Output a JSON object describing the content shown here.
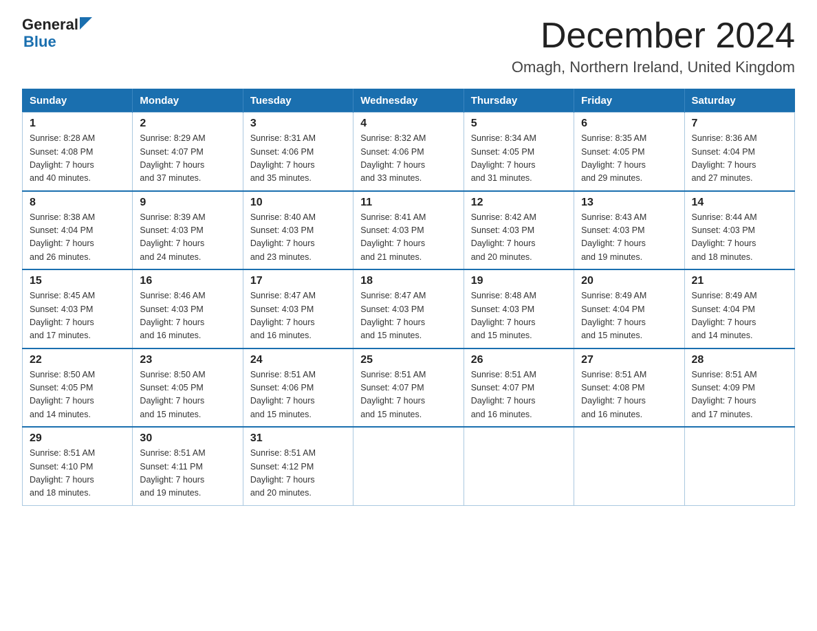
{
  "logo": {
    "line1": "General",
    "arrow": true,
    "line2": "Blue"
  },
  "title": "December 2024",
  "subtitle": "Omagh, Northern Ireland, United Kingdom",
  "days_of_week": [
    "Sunday",
    "Monday",
    "Tuesday",
    "Wednesday",
    "Thursday",
    "Friday",
    "Saturday"
  ],
  "weeks": [
    [
      {
        "day": "1",
        "sunrise": "8:28 AM",
        "sunset": "4:08 PM",
        "daylight": "7 hours and 40 minutes."
      },
      {
        "day": "2",
        "sunrise": "8:29 AM",
        "sunset": "4:07 PM",
        "daylight": "7 hours and 37 minutes."
      },
      {
        "day": "3",
        "sunrise": "8:31 AM",
        "sunset": "4:06 PM",
        "daylight": "7 hours and 35 minutes."
      },
      {
        "day": "4",
        "sunrise": "8:32 AM",
        "sunset": "4:06 PM",
        "daylight": "7 hours and 33 minutes."
      },
      {
        "day": "5",
        "sunrise": "8:34 AM",
        "sunset": "4:05 PM",
        "daylight": "7 hours and 31 minutes."
      },
      {
        "day": "6",
        "sunrise": "8:35 AM",
        "sunset": "4:05 PM",
        "daylight": "7 hours and 29 minutes."
      },
      {
        "day": "7",
        "sunrise": "8:36 AM",
        "sunset": "4:04 PM",
        "daylight": "7 hours and 27 minutes."
      }
    ],
    [
      {
        "day": "8",
        "sunrise": "8:38 AM",
        "sunset": "4:04 PM",
        "daylight": "7 hours and 26 minutes."
      },
      {
        "day": "9",
        "sunrise": "8:39 AM",
        "sunset": "4:03 PM",
        "daylight": "7 hours and 24 minutes."
      },
      {
        "day": "10",
        "sunrise": "8:40 AM",
        "sunset": "4:03 PM",
        "daylight": "7 hours and 23 minutes."
      },
      {
        "day": "11",
        "sunrise": "8:41 AM",
        "sunset": "4:03 PM",
        "daylight": "7 hours and 21 minutes."
      },
      {
        "day": "12",
        "sunrise": "8:42 AM",
        "sunset": "4:03 PM",
        "daylight": "7 hours and 20 minutes."
      },
      {
        "day": "13",
        "sunrise": "8:43 AM",
        "sunset": "4:03 PM",
        "daylight": "7 hours and 19 minutes."
      },
      {
        "day": "14",
        "sunrise": "8:44 AM",
        "sunset": "4:03 PM",
        "daylight": "7 hours and 18 minutes."
      }
    ],
    [
      {
        "day": "15",
        "sunrise": "8:45 AM",
        "sunset": "4:03 PM",
        "daylight": "7 hours and 17 minutes."
      },
      {
        "day": "16",
        "sunrise": "8:46 AM",
        "sunset": "4:03 PM",
        "daylight": "7 hours and 16 minutes."
      },
      {
        "day": "17",
        "sunrise": "8:47 AM",
        "sunset": "4:03 PM",
        "daylight": "7 hours and 16 minutes."
      },
      {
        "day": "18",
        "sunrise": "8:47 AM",
        "sunset": "4:03 PM",
        "daylight": "7 hours and 15 minutes."
      },
      {
        "day": "19",
        "sunrise": "8:48 AM",
        "sunset": "4:03 PM",
        "daylight": "7 hours and 15 minutes."
      },
      {
        "day": "20",
        "sunrise": "8:49 AM",
        "sunset": "4:04 PM",
        "daylight": "7 hours and 15 minutes."
      },
      {
        "day": "21",
        "sunrise": "8:49 AM",
        "sunset": "4:04 PM",
        "daylight": "7 hours and 14 minutes."
      }
    ],
    [
      {
        "day": "22",
        "sunrise": "8:50 AM",
        "sunset": "4:05 PM",
        "daylight": "7 hours and 14 minutes."
      },
      {
        "day": "23",
        "sunrise": "8:50 AM",
        "sunset": "4:05 PM",
        "daylight": "7 hours and 15 minutes."
      },
      {
        "day": "24",
        "sunrise": "8:51 AM",
        "sunset": "4:06 PM",
        "daylight": "7 hours and 15 minutes."
      },
      {
        "day": "25",
        "sunrise": "8:51 AM",
        "sunset": "4:07 PM",
        "daylight": "7 hours and 15 minutes."
      },
      {
        "day": "26",
        "sunrise": "8:51 AM",
        "sunset": "4:07 PM",
        "daylight": "7 hours and 16 minutes."
      },
      {
        "day": "27",
        "sunrise": "8:51 AM",
        "sunset": "4:08 PM",
        "daylight": "7 hours and 16 minutes."
      },
      {
        "day": "28",
        "sunrise": "8:51 AM",
        "sunset": "4:09 PM",
        "daylight": "7 hours and 17 minutes."
      }
    ],
    [
      {
        "day": "29",
        "sunrise": "8:51 AM",
        "sunset": "4:10 PM",
        "daylight": "7 hours and 18 minutes."
      },
      {
        "day": "30",
        "sunrise": "8:51 AM",
        "sunset": "4:11 PM",
        "daylight": "7 hours and 19 minutes."
      },
      {
        "day": "31",
        "sunrise": "8:51 AM",
        "sunset": "4:12 PM",
        "daylight": "7 hours and 20 minutes."
      },
      null,
      null,
      null,
      null
    ]
  ],
  "labels": {
    "sunrise": "Sunrise:",
    "sunset": "Sunset:",
    "daylight": "Daylight:"
  }
}
